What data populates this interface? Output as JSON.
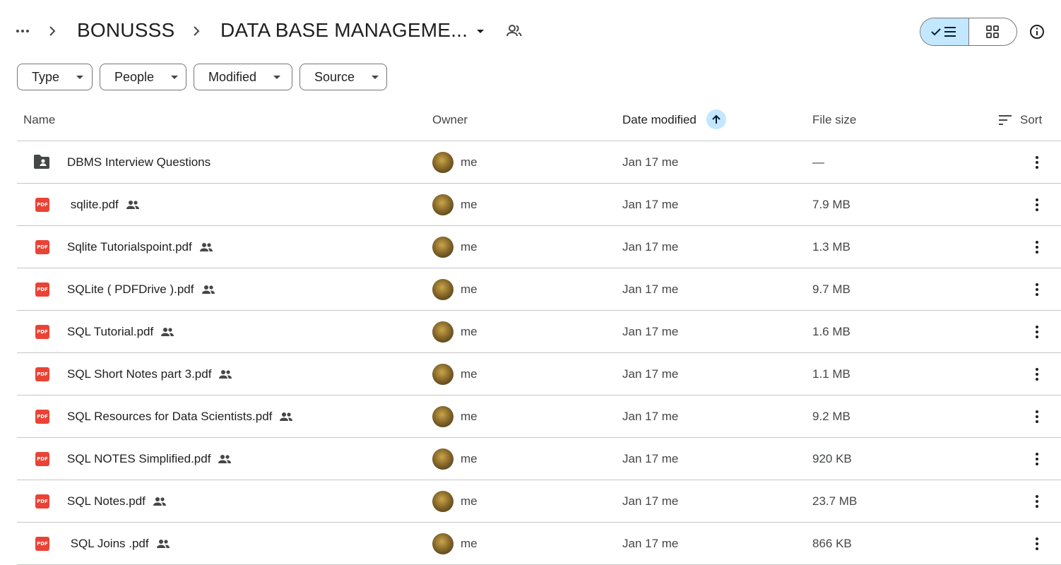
{
  "breadcrumb": {
    "parent": "BONUSSS",
    "current": "DATA BASE MANAGEME..."
  },
  "filters": [
    "Type",
    "People",
    "Modified",
    "Source"
  ],
  "columns": {
    "name": "Name",
    "owner": "Owner",
    "date_modified": "Date modified",
    "file_size": "File size",
    "sort": "Sort"
  },
  "colors": {
    "accent": "#c2e7ff",
    "pdf": "#ea4335"
  },
  "rows": [
    {
      "type": "folder",
      "name": "DBMS Interview Questions",
      "shared": false,
      "owner": "me",
      "date": "Jan 17 me",
      "size": "—"
    },
    {
      "type": "pdf",
      "name": " sqlite.pdf",
      "shared": true,
      "owner": "me",
      "date": "Jan 17 me",
      "size": "7.9 MB"
    },
    {
      "type": "pdf",
      "name": "Sqlite Tutorialspoint.pdf",
      "shared": true,
      "owner": "me",
      "date": "Jan 17 me",
      "size": "1.3 MB"
    },
    {
      "type": "pdf",
      "name": "SQLite ( PDFDrive ).pdf",
      "shared": true,
      "owner": "me",
      "date": "Jan 17 me",
      "size": "9.7 MB"
    },
    {
      "type": "pdf",
      "name": "SQL Tutorial.pdf",
      "shared": true,
      "owner": "me",
      "date": "Jan 17 me",
      "size": "1.6 MB"
    },
    {
      "type": "pdf",
      "name": "SQL Short Notes part 3.pdf",
      "shared": true,
      "owner": "me",
      "date": "Jan 17 me",
      "size": "1.1 MB"
    },
    {
      "type": "pdf",
      "name": "SQL Resources for Data Scientists.pdf",
      "shared": true,
      "owner": "me",
      "date": "Jan 17 me",
      "size": "9.2 MB"
    },
    {
      "type": "pdf",
      "name": "SQL NOTES Simplified.pdf",
      "shared": true,
      "owner": "me",
      "date": "Jan 17 me",
      "size": "920 KB"
    },
    {
      "type": "pdf",
      "name": "SQL Notes.pdf",
      "shared": true,
      "owner": "me",
      "date": "Jan 17 me",
      "size": "23.7 MB"
    },
    {
      "type": "pdf",
      "name": " SQL Joins .pdf",
      "shared": true,
      "owner": "me",
      "date": "Jan 17 me",
      "size": "866 KB"
    }
  ],
  "pdf_badge": "PDF"
}
